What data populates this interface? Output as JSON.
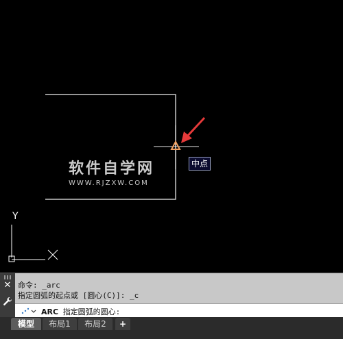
{
  "tooltip": {
    "text": "中点"
  },
  "watermark": {
    "title": "软件自学网",
    "url": "WWW.RJZXW.COM"
  },
  "ucs": {
    "y_label": "Y"
  },
  "command": {
    "history": [
      "命令: _arc",
      "指定圆弧的起点或 [圆心(C)]: _c"
    ],
    "prompt_cmd": "ARC",
    "prompt_text": "指定圆弧的圆心:"
  },
  "tabs": [
    "模型",
    "布局1",
    "布局2"
  ],
  "colors": {
    "background": "#000000",
    "drawing_lines": "#c8c8c8",
    "snap_marker": "#f0a060",
    "annotation_arrow": "#e63a3a"
  },
  "icons": {
    "close": "close-icon",
    "settings": "wrench-icon",
    "add_tab": "plus-icon"
  }
}
